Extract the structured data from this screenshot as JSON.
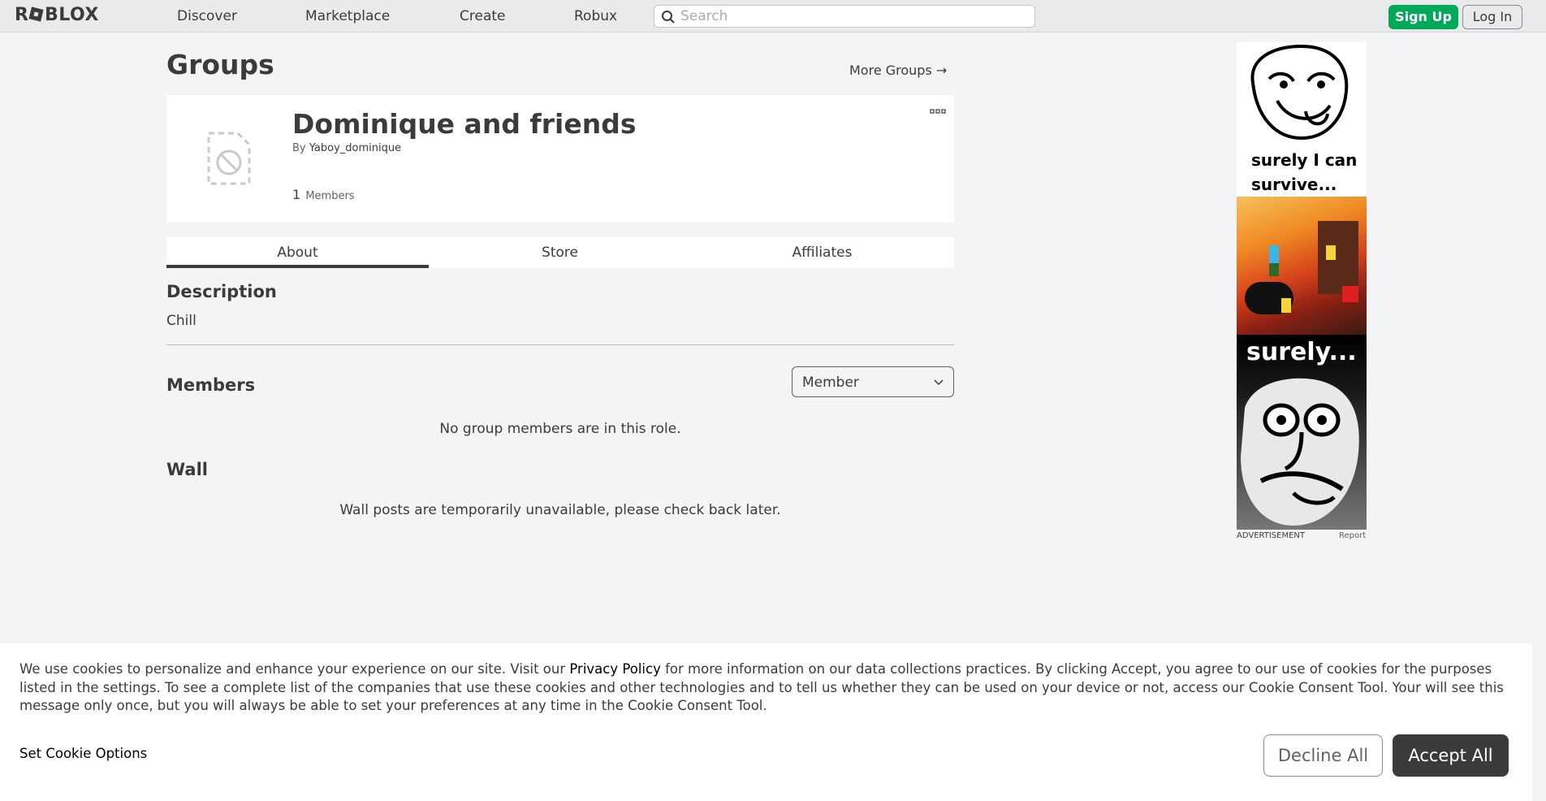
{
  "nav": {
    "logo": "R▪BLOX",
    "links": [
      "Discover",
      "Marketplace",
      "Create",
      "Robux"
    ],
    "search_placeholder": "Search",
    "signup": "Sign Up",
    "login": "Log In"
  },
  "page": {
    "title": "Groups",
    "more_groups": "More Groups →"
  },
  "group": {
    "name": "Dominique and friends",
    "by_prefix": "By",
    "owner": "Yaboy_dominique",
    "member_count": "1",
    "members_label": "Members"
  },
  "tabs": [
    "About",
    "Store",
    "Affiliates"
  ],
  "about": {
    "description_title": "Description",
    "description": "Chill",
    "members_title": "Members",
    "role_selected": "Member",
    "no_members": "No group members are in this role.",
    "wall_title": "Wall",
    "wall_message": "Wall posts are temporarily unavailable, please check back later."
  },
  "ad": {
    "text1_line1": "surely I can",
    "text1_line2": "survive...",
    "text2": "surely...",
    "label": "ADVERTISEMENT",
    "report": "Report"
  },
  "cookie": {
    "text_before": "We use cookies to personalize and enhance your experience on our site. Visit our ",
    "privacy_link": "Privacy Policy",
    "text_after": " for more information on our data collections practices. By clicking Accept, you agree to our use of cookies for the purposes listed in the settings. To see a complete list of the companies that use these cookies and other technologies and to tell us whether they can be used on your device or not, access our Cookie Consent Tool. Your will see this message only once, but you will always be able to set your preferences at any time in the Cookie Consent Tool.",
    "set_options": "Set Cookie Options",
    "decline": "Decline All",
    "accept": "Accept All"
  },
  "colors": {
    "signup_green": "#00a859",
    "accept_dark": "#393b3d",
    "background": "#f2f4f5"
  }
}
